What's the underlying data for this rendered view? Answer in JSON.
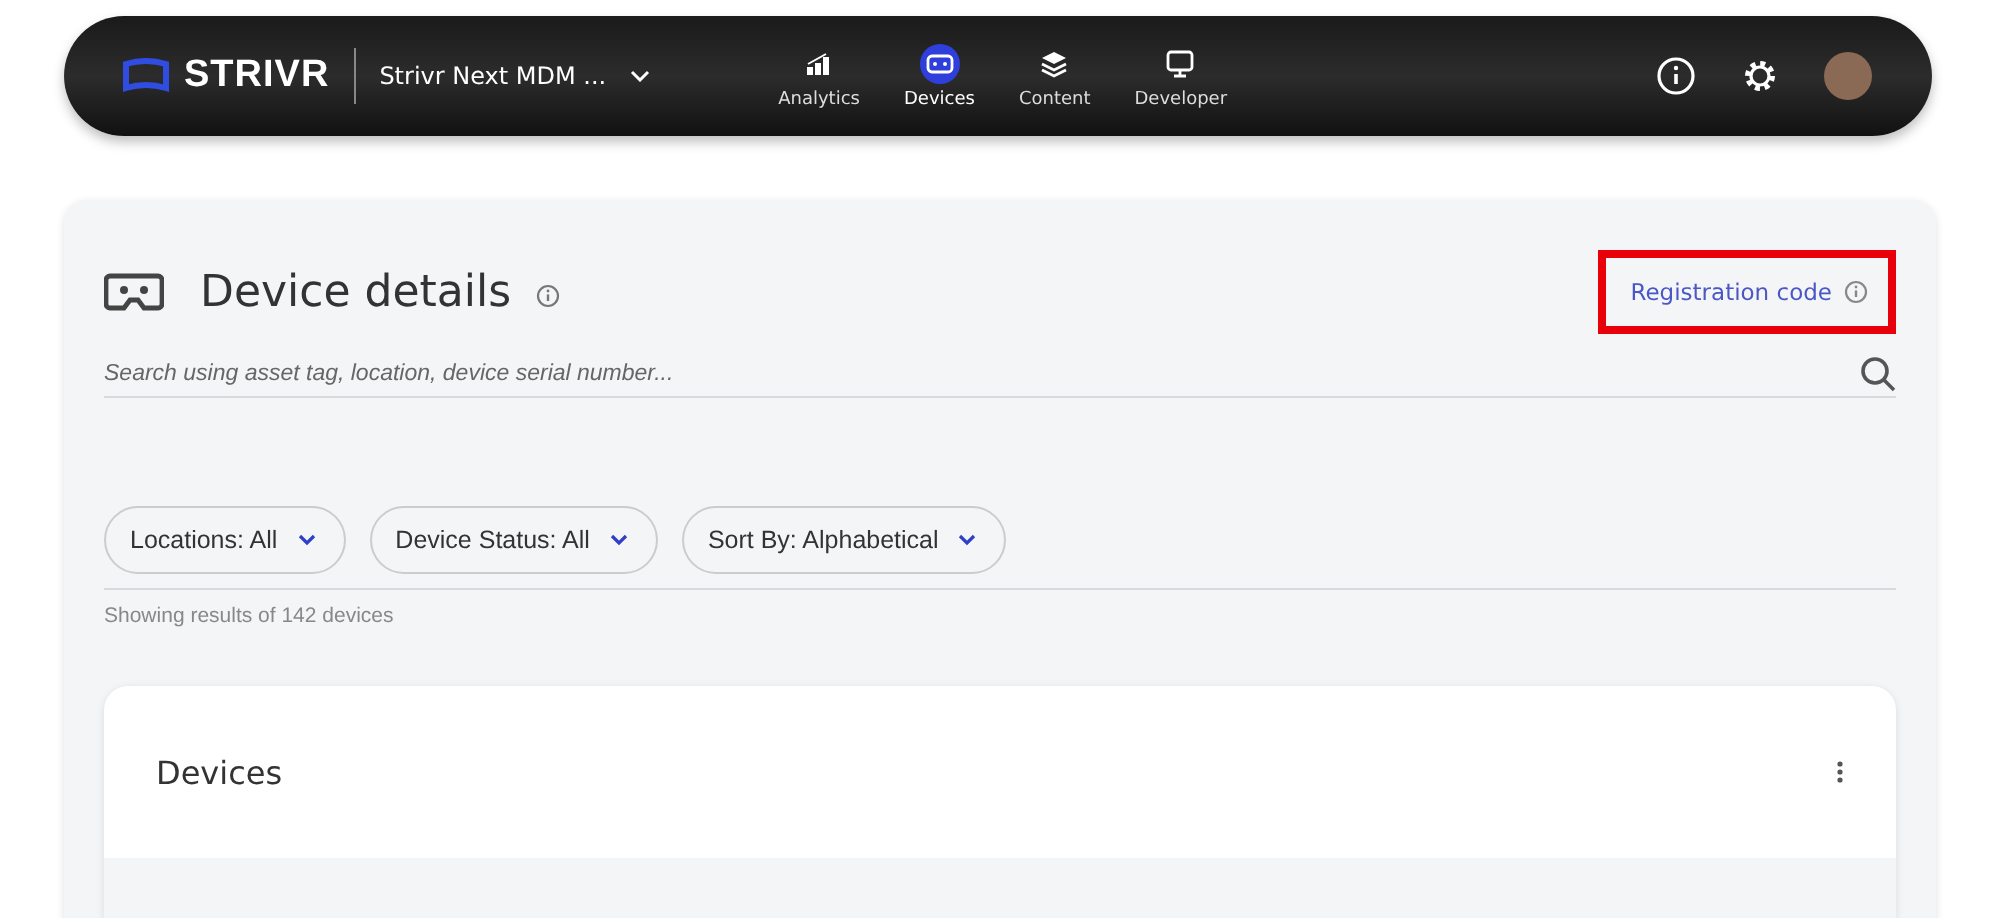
{
  "header": {
    "brand": "STRIVR",
    "workspace": "Strivr Next MDM ...",
    "nav": [
      {
        "label": "Analytics",
        "kind": "chart",
        "selected": false
      },
      {
        "label": "Devices",
        "kind": "headset",
        "selected": true
      },
      {
        "label": "Content",
        "kind": "layers",
        "selected": false
      },
      {
        "label": "Developer",
        "kind": "monitor",
        "selected": false
      }
    ]
  },
  "page": {
    "title": "Device details",
    "registration_link": "Registration code",
    "search": {
      "placeholder": "Search using asset tag, location, device serial number..."
    },
    "filters": [
      "Locations: All",
      "Device Status: All",
      "Sort By: Alphabetical"
    ],
    "results": "Showing results of 142 devices"
  },
  "devices_card": {
    "title": "Devices"
  }
}
